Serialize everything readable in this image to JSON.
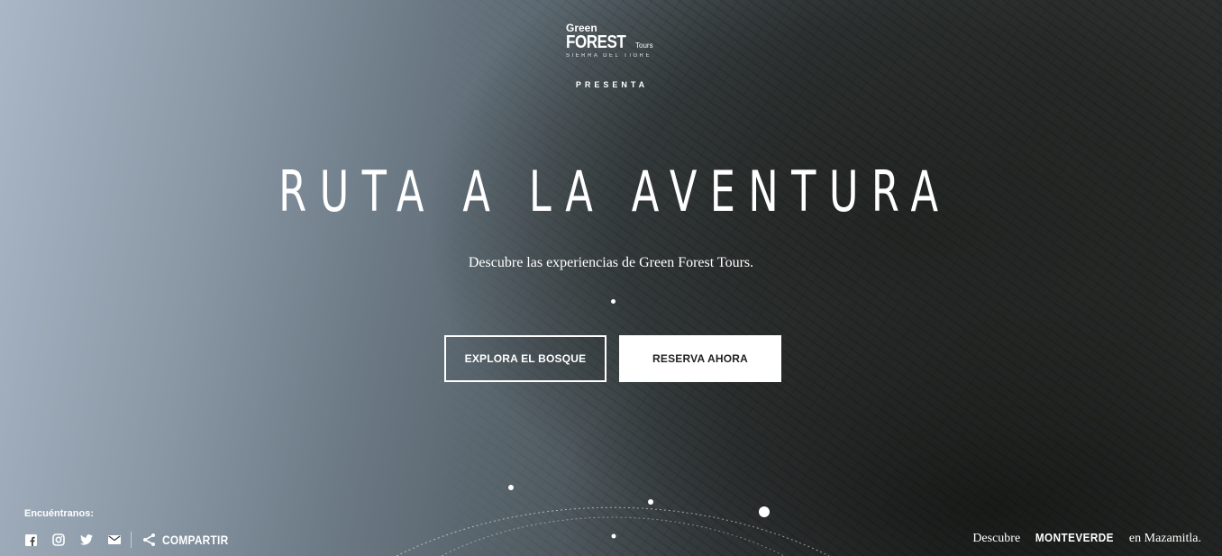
{
  "logo": {
    "line1": "Green",
    "line2": "FOREST",
    "line2_suffix": "Tours",
    "line3": "SIERRA DEL TIGRE"
  },
  "presenta": "PRESENTA",
  "hero": {
    "title": "RUTA A LA AVENTURA",
    "subtitle": "Descubre las experiencias de Green Forest Tours."
  },
  "buttons": {
    "explore": "EXPLORA EL BOSQUE",
    "reserve": "RESERVA AHORA"
  },
  "footer": {
    "find_label": "Encuéntranos:",
    "social_icons": [
      "facebook-icon",
      "instagram-icon",
      "twitter-icon",
      "email-icon"
    ],
    "share_label": "COMPARTIR",
    "discover_prefix": "Descubre",
    "discover_brand": "MONTEVERDE",
    "discover_suffix": "en Mazamitla."
  }
}
